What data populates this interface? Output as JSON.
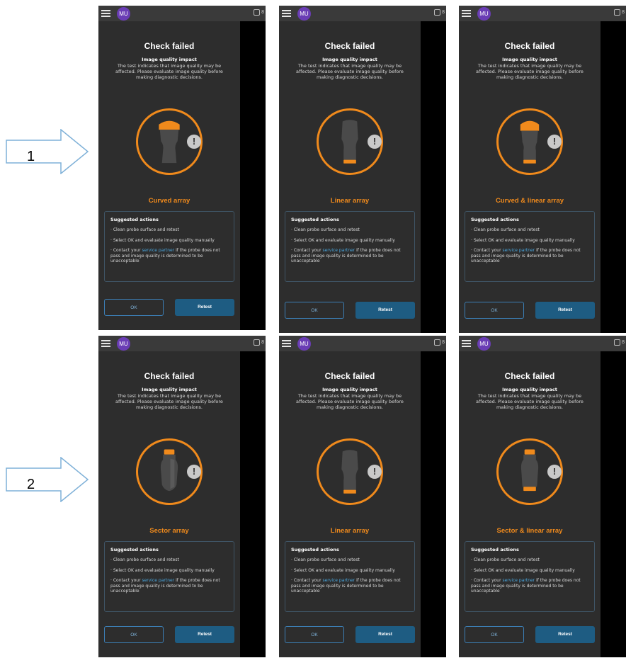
{
  "colors": {
    "panel_bg": "#2d2d2d",
    "accent_orange": "#f08a1c",
    "link_blue": "#4aa8e0",
    "retest_bg": "#1e5c82",
    "avatar_bg": "#6a3db5"
  },
  "arrows": [
    "1",
    "2"
  ],
  "panel_common": {
    "avatar": "MU",
    "battery": "8",
    "title": "Check failed",
    "subtitle": "Image quality impact",
    "desc_line1": "The test indicates that image quality may be",
    "desc_line2": "affected. Please evaluate image quality before",
    "desc_line3": "making diagnostic decisions.",
    "alert_symbol": "!",
    "actions_title": "Suggested actions",
    "action1": "Clean probe surface and retest",
    "action2": "Select OK and evaluate image quality manually",
    "action3_pre": "Contact your ",
    "action3_link": "service partner",
    "action3_post": " if the probe does not pass and image quality is determined to be unacceptable",
    "ok_label": "OK",
    "retest_label": "Retest"
  },
  "panels": [
    {
      "probe": "Curved array",
      "probe_icon": "curved-array-probe-icon"
    },
    {
      "probe": "Linear array",
      "probe_icon": "linear-array-probe-icon"
    },
    {
      "probe": "Curved & linear array",
      "probe_icon": "curved-linear-array-probe-icon"
    },
    {
      "probe": "Sector array",
      "probe_icon": "sector-array-probe-icon"
    },
    {
      "probe": "Linear array",
      "probe_icon": "linear-array-probe-icon"
    },
    {
      "probe": "Sector & linear array",
      "probe_icon": "sector-linear-array-probe-icon"
    }
  ]
}
